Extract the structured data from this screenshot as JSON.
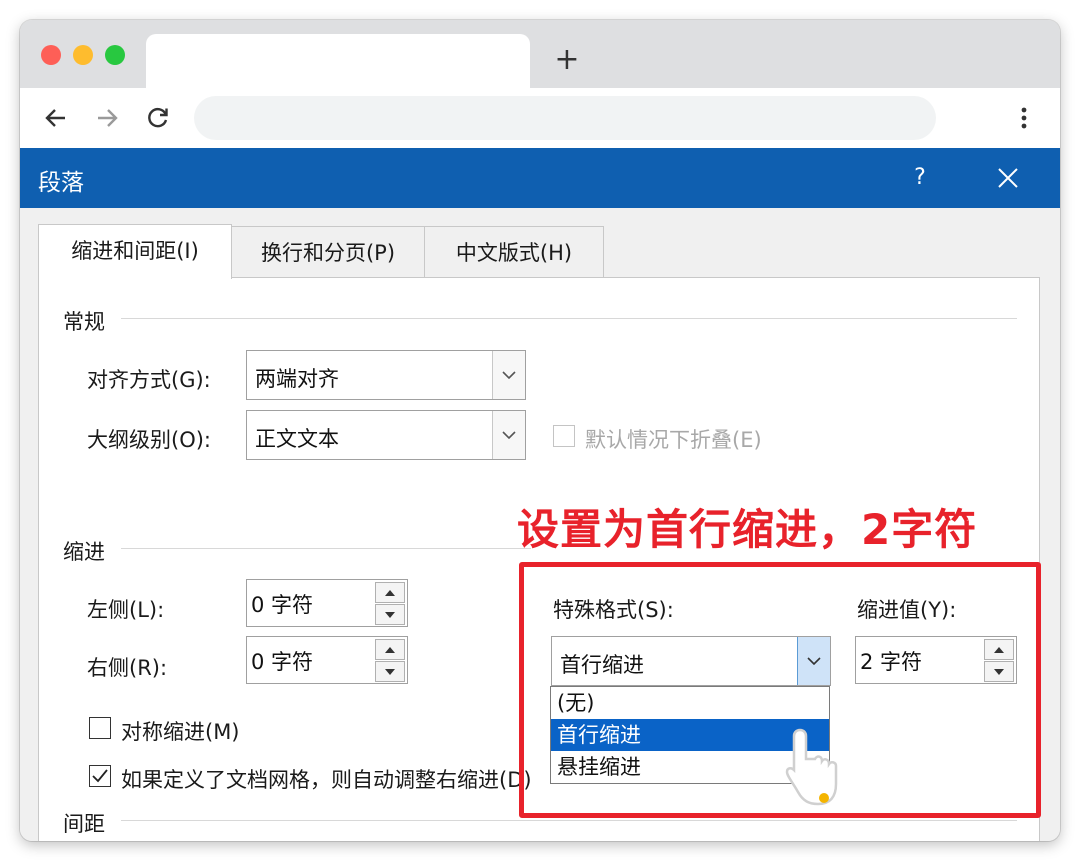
{
  "browser": {
    "new_tab_glyph": "+",
    "back_icon": "arrow-left",
    "forward_icon": "arrow-right",
    "reload_icon": "reload",
    "menu_icon": "kebab-menu",
    "traffic_colors": [
      "#fe5f57",
      "#febc2e",
      "#28c840"
    ]
  },
  "dialog": {
    "title": "段落",
    "help_label": "?",
    "accent": "#0f5fb0",
    "tabs": [
      {
        "label": "缩进和间距(I)",
        "active": true
      },
      {
        "label": "换行和分页(P)",
        "active": false
      },
      {
        "label": "中文版式(H)",
        "active": false
      }
    ],
    "general": {
      "section": "常规",
      "alignment_label": "对齐方式(G):",
      "alignment_value": "两端对齐",
      "outline_label": "大纲级别(O):",
      "outline_value": "正文文本",
      "collapse_label": "默认情况下折叠(E)"
    },
    "indent": {
      "section": "缩进",
      "left_label": "左侧(L):",
      "left_value": "0 字符",
      "right_label": "右侧(R):",
      "right_value": "0 字符",
      "special_label": "特殊格式(S):",
      "special_value": "首行缩进",
      "by_label": "缩进值(Y):",
      "by_value": "2 字符",
      "mirror_label": "对称缩进(M)",
      "auto_adjust_label": "如果定义了文档网格，则自动调整右缩进(D)",
      "dropdown_options": [
        "(无)",
        "首行缩进",
        "悬挂缩进"
      ],
      "dropdown_selected": "首行缩进"
    },
    "spacing": {
      "section": "间距"
    }
  },
  "annotation": {
    "text": "设置为首行缩进，2字符",
    "color": "#e8222b"
  }
}
